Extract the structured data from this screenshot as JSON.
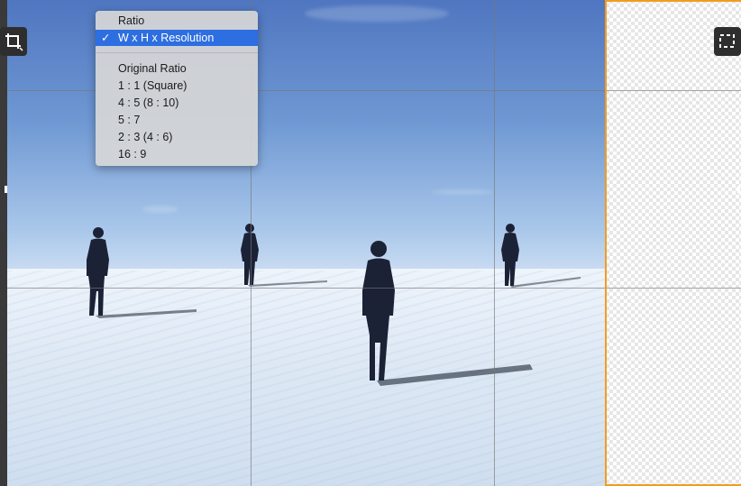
{
  "ratio_menu": {
    "header": "Ratio",
    "selected": {
      "check": "✓",
      "label": "W x H x Resolution"
    },
    "options": [
      "Original Ratio",
      "1 : 1 (Square)",
      "4 : 5 (8 : 10)",
      "5 : 7",
      "2 : 3 (4 : 6)",
      "16 : 9"
    ]
  },
  "toolbar": {
    "left_tool_icon": "crop-icon",
    "right_tool_icon": "marquee-select-icon"
  },
  "colors": {
    "crop_border": "#f39c1f",
    "menu_highlight": "#2d6ee0"
  }
}
